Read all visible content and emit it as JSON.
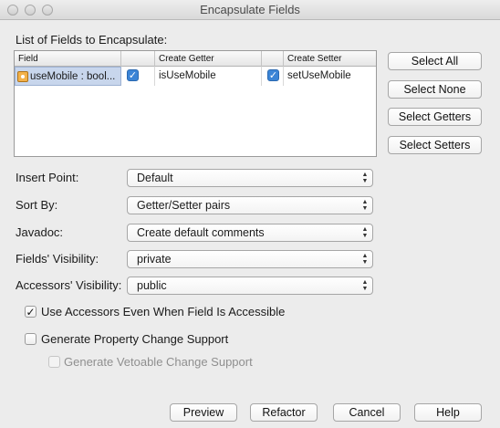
{
  "window": {
    "title": "Encapsulate Fields"
  },
  "fields_table": {
    "section_label": "List of Fields to Encapsulate:",
    "columns": [
      "Field",
      "",
      "Create Getter",
      "",
      "Create Setter"
    ],
    "rows": [
      {
        "field": "useMobile : bool...",
        "getter_checked": true,
        "getter": "isUseMobile",
        "setter_checked": true,
        "setter": "setUseMobile"
      }
    ]
  },
  "side_buttons": {
    "select_all": "Select All",
    "select_none": "Select None",
    "select_getters": "Select Getters",
    "select_setters": "Select Setters"
  },
  "options": {
    "insert_point": {
      "label": "Insert Point:",
      "value": "Default"
    },
    "sort_by": {
      "label": "Sort By:",
      "value": "Getter/Setter pairs"
    },
    "javadoc": {
      "label": "Javadoc:",
      "value": "Create default comments"
    },
    "fields_visibility": {
      "label": "Fields' Visibility:",
      "value": "private"
    },
    "accessors_visibility": {
      "label": "Accessors' Visibility:",
      "value": "public"
    }
  },
  "checkboxes": {
    "use_accessors": {
      "label": "Use Accessors Even When Field Is Accessible",
      "checked": true
    },
    "property_change": {
      "label": "Generate Property Change Support",
      "checked": false
    },
    "vetoable_change": {
      "label": "Generate Vetoable Change Support",
      "checked": false,
      "disabled": true
    }
  },
  "footer": {
    "preview": "Preview",
    "refactor": "Refactor",
    "cancel": "Cancel",
    "help": "Help"
  },
  "glyphs": {
    "check": "✓",
    "select_arrows_up": "▲",
    "select_arrows_down": "▼"
  }
}
